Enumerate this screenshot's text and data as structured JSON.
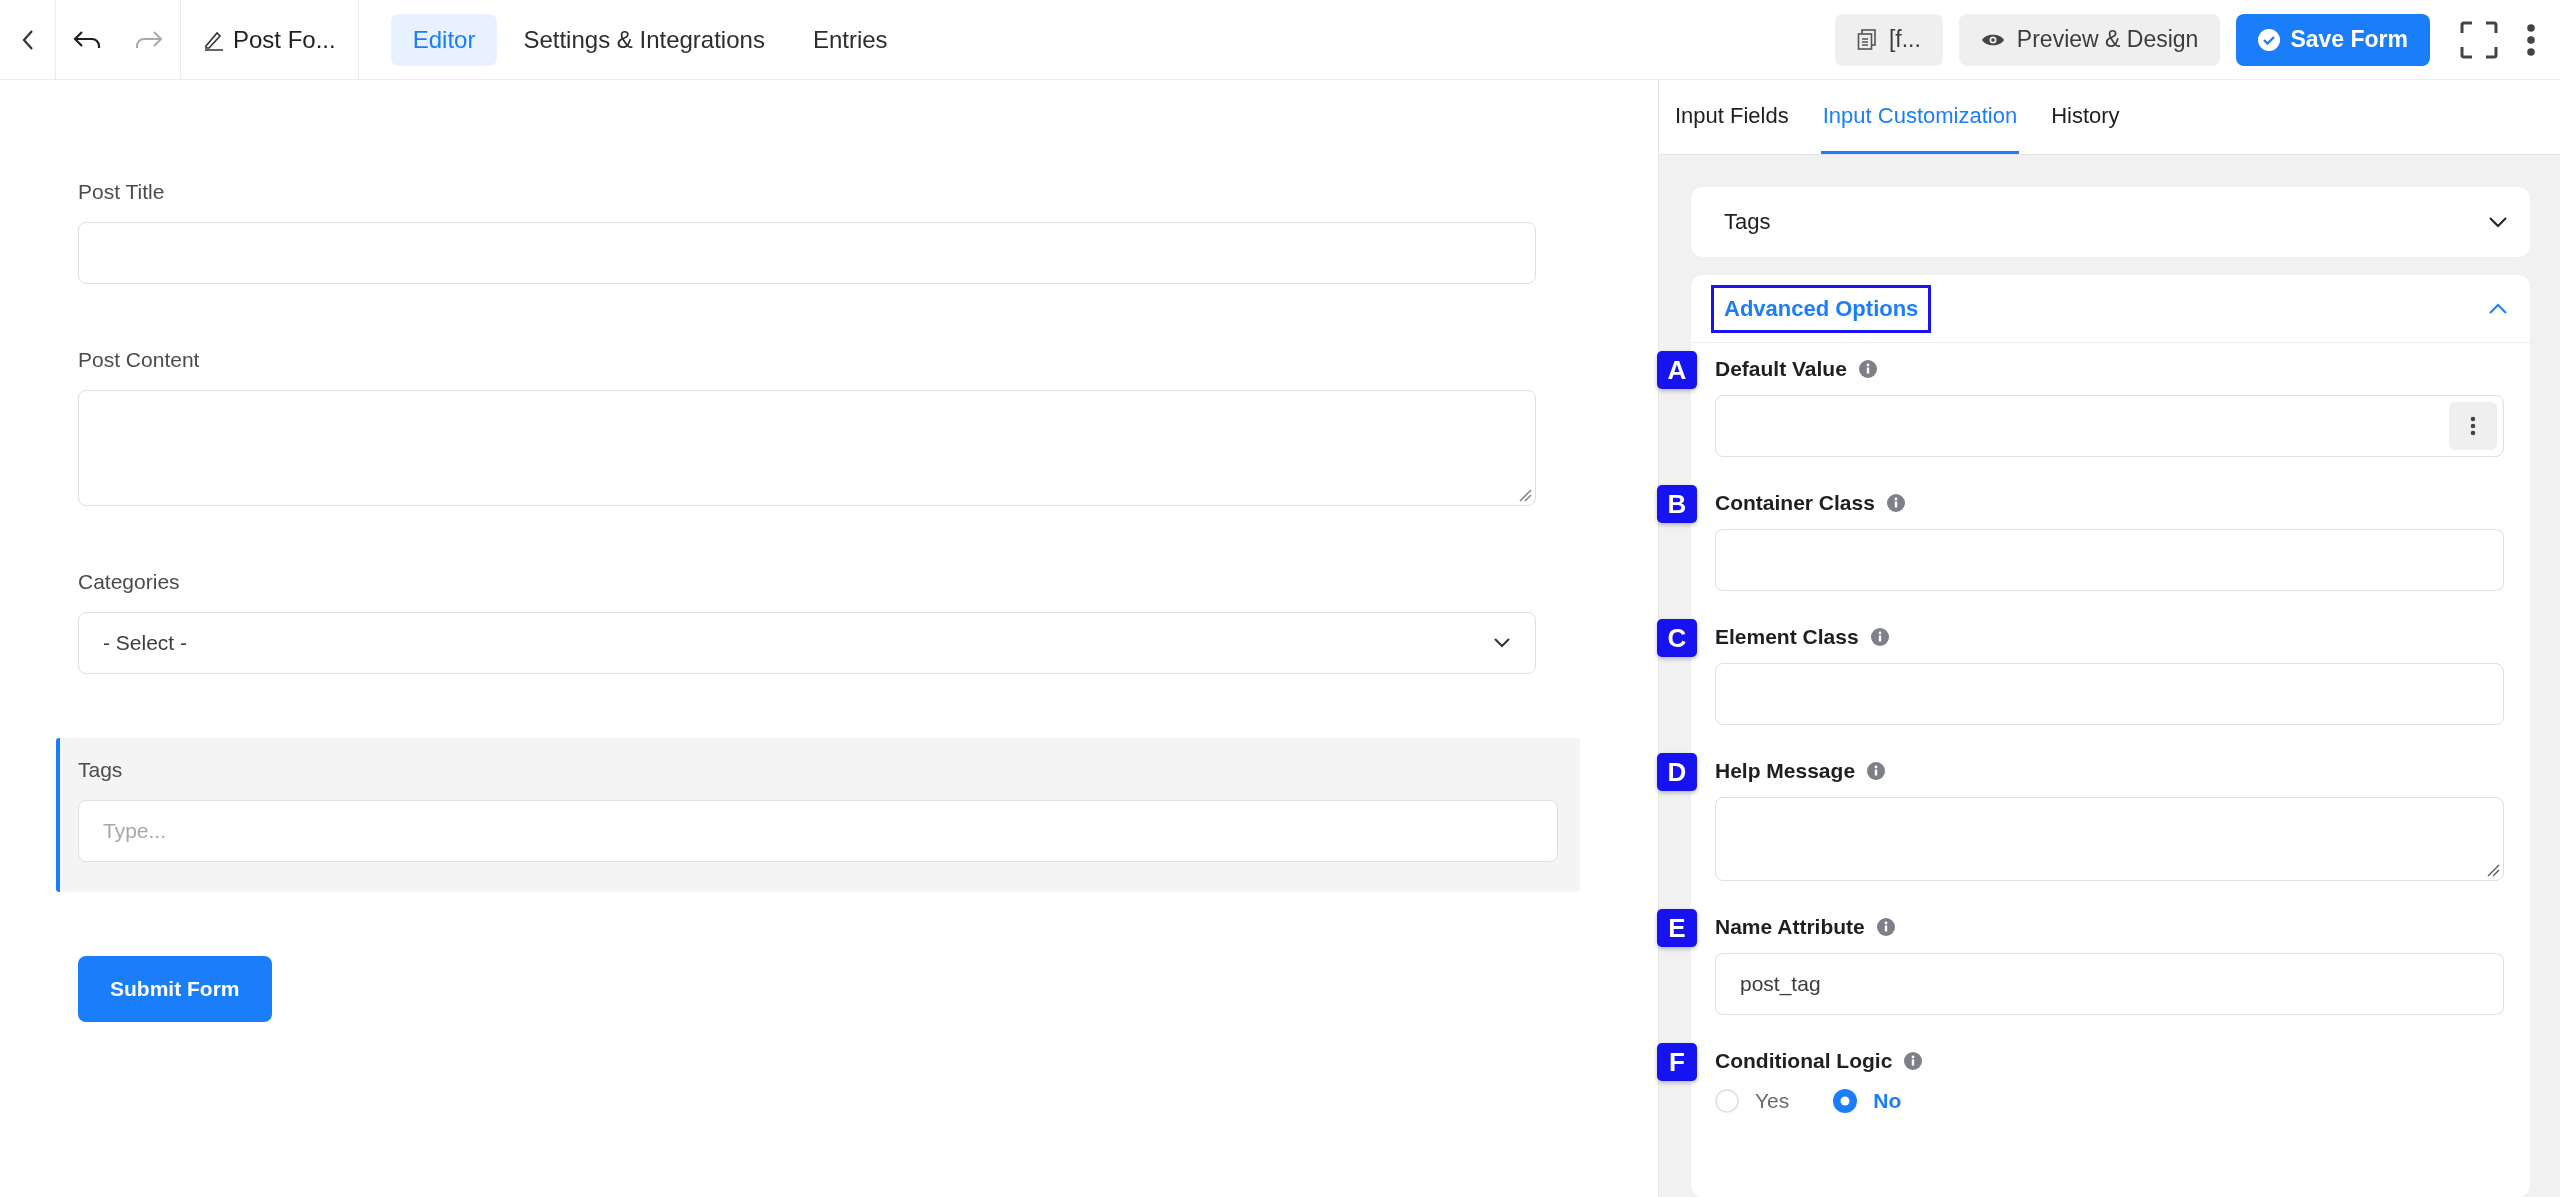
{
  "toolbar": {
    "title": "Post Fo...",
    "tabs": [
      {
        "label": "Editor",
        "selected": true
      },
      {
        "label": "Settings & Integrations",
        "selected": false
      },
      {
        "label": "Entries",
        "selected": false
      }
    ],
    "shortcode_button": "[f...",
    "preview_button": "Preview & Design",
    "save_button": "Save Form"
  },
  "form": {
    "fields": [
      {
        "kind": "input",
        "label": "Post Title",
        "selected": false
      },
      {
        "kind": "textarea",
        "label": "Post Content",
        "selected": false
      },
      {
        "kind": "select",
        "label": "Categories",
        "value": "- Select -",
        "selected": false
      },
      {
        "kind": "input",
        "label": "Tags",
        "placeholder": "Type...",
        "selected": true
      }
    ],
    "submit_button": "Submit Form"
  },
  "panel": {
    "tabs": [
      {
        "label": "Input Fields",
        "selected": false
      },
      {
        "label": "Input Customization",
        "selected": true
      },
      {
        "label": "History",
        "selected": false
      }
    ],
    "sections": [
      {
        "title": "Tags",
        "expanded": false,
        "outlined": false
      },
      {
        "title": "Advanced Options",
        "expanded": true,
        "outlined": true
      }
    ],
    "options": [
      {
        "badge": "A",
        "label": "Default Value",
        "kind": "input_menu"
      },
      {
        "badge": "B",
        "label": "Container Class",
        "kind": "input"
      },
      {
        "badge": "C",
        "label": "Element Class",
        "kind": "input"
      },
      {
        "badge": "D",
        "label": "Help Message",
        "kind": "textarea"
      },
      {
        "badge": "E",
        "label": "Name Attribute",
        "kind": "input",
        "value": "post_tag"
      },
      {
        "badge": "F",
        "label": "Conditional Logic",
        "kind": "radio",
        "choices": [
          {
            "label": "Yes",
            "selected": false
          },
          {
            "label": "No",
            "selected": true
          }
        ]
      }
    ]
  }
}
